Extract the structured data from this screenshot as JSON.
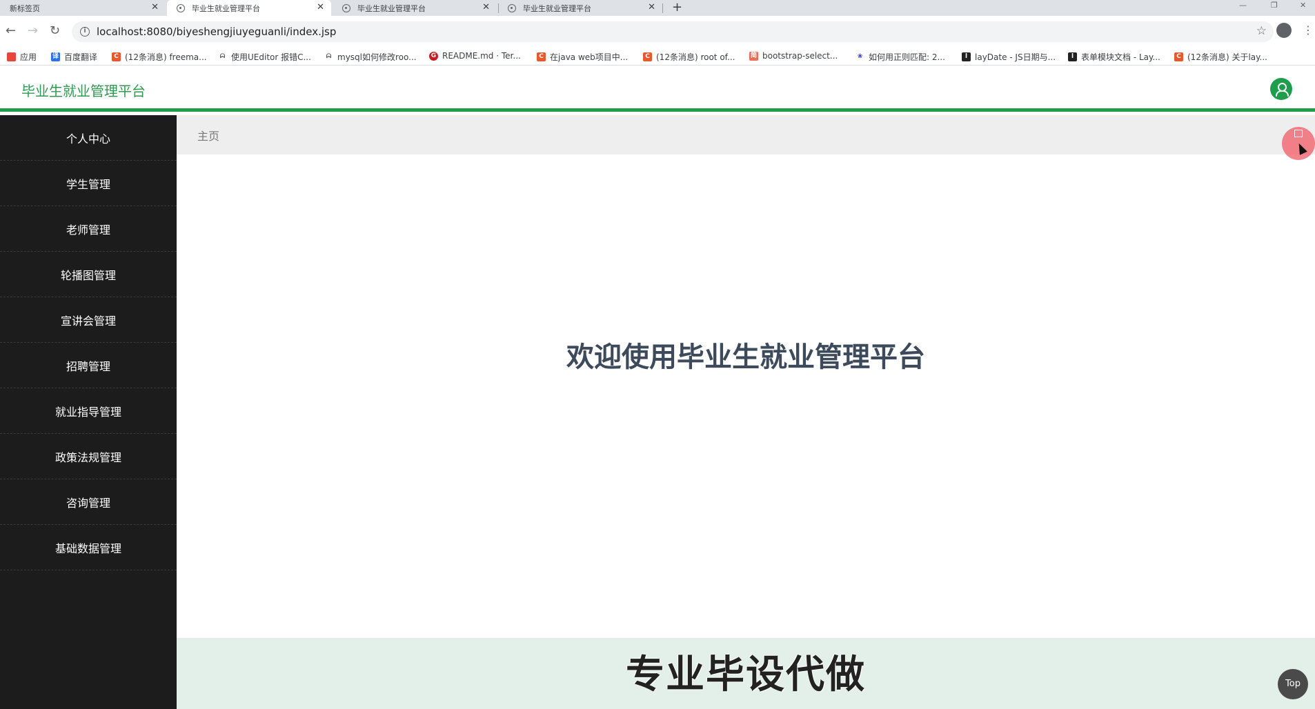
{
  "browser": {
    "tabs": [
      {
        "label": "新标签页",
        "active": false
      },
      {
        "label": "毕业生就业管理平台",
        "active": true
      },
      {
        "label": "毕业生就业管理平台",
        "active": false
      },
      {
        "label": "毕业生就业管理平台",
        "active": false
      }
    ],
    "new_tab": "+",
    "url": "localhost:8080/biyeshengjiuyeguanli/index.jsp",
    "bookmarks": [
      {
        "label": "应用",
        "icon": "apps-icon",
        "color": "#e8453c"
      },
      {
        "label": "百度翻译",
        "icon": "translate-icon",
        "color": "#2b73e8"
      },
      {
        "label": "(12条消息) freema...",
        "icon": "csdn-icon",
        "color": "#e8582a"
      },
      {
        "label": "使用UEditor 报错C...",
        "icon": "bird-icon",
        "color": "#555555"
      },
      {
        "label": "mysql如何修改roo...",
        "icon": "bird-icon",
        "color": "#555555"
      },
      {
        "label": "README.md · Ter...",
        "icon": "gitee-icon",
        "color": "#c71d23"
      },
      {
        "label": "在java web项目中...",
        "icon": "csdn-icon",
        "color": "#e8582a"
      },
      {
        "label": "(12条消息) root of...",
        "icon": "csdn-icon",
        "color": "#e8582a"
      },
      {
        "label": "bootstrap-select...",
        "icon": "jianshu-icon",
        "color": "#ea6f5a"
      },
      {
        "label": "如何用正则匹配: 2...",
        "icon": "baidu-icon",
        "color": "#2932e1"
      },
      {
        "label": "layDate - JS日期与...",
        "icon": "layui-icon",
        "color": "#222222"
      },
      {
        "label": "表单模块文档 - Lay...",
        "icon": "layui-icon",
        "color": "#222222"
      },
      {
        "label": "(12条消息) 关于lay...",
        "icon": "csdn-icon",
        "color": "#e8582a"
      }
    ]
  },
  "app": {
    "title": "毕业生就业管理平台",
    "accent": "#1e9e4a"
  },
  "sidebar": {
    "items": [
      {
        "label": "个人中心"
      },
      {
        "label": "学生管理"
      },
      {
        "label": "老师管理"
      },
      {
        "label": "轮播图管理"
      },
      {
        "label": "宣讲会管理"
      },
      {
        "label": "招聘管理"
      },
      {
        "label": "就业指导管理"
      },
      {
        "label": "政策法规管理"
      },
      {
        "label": "咨询管理"
      },
      {
        "label": "基础数据管理"
      }
    ]
  },
  "main": {
    "breadcrumb": "主页",
    "welcome": "欢迎使用毕业生就业管理平台",
    "promo": "专业毕设代做",
    "top_button": "Top"
  }
}
